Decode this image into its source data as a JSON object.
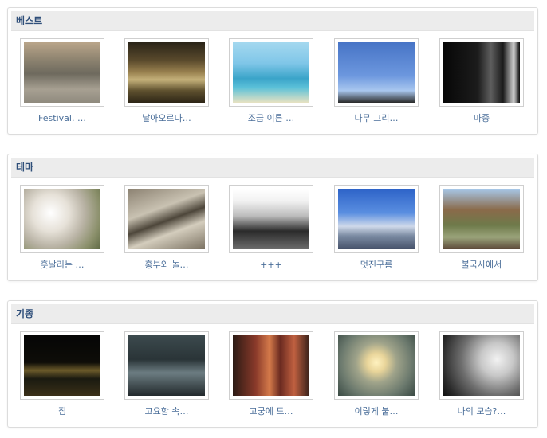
{
  "sections": [
    {
      "title": "베스트",
      "items": [
        {
          "caption": "Festival. …",
          "photo": "festival-street"
        },
        {
          "caption": "날아오르다…",
          "photo": "waves-sunset"
        },
        {
          "caption": "조금 이른 …",
          "photo": "beach-woman"
        },
        {
          "caption": "나무 그리…",
          "photo": "trees-silhouette"
        },
        {
          "caption": "마중",
          "photo": "dark-doorway"
        }
      ]
    },
    {
      "title": "테마",
      "items": [
        {
          "caption": "흣날리는 …",
          "photo": "dandelion"
        },
        {
          "caption": "홍부와 놀…",
          "photo": "salt-farm"
        },
        {
          "caption": "+++",
          "photo": "couple-silhouette"
        },
        {
          "caption": "멋진구름",
          "photo": "city-clouds"
        },
        {
          "caption": "불국사에서",
          "photo": "temple"
        }
      ]
    },
    {
      "title": "기종",
      "items": [
        {
          "caption": "집",
          "photo": "night-house"
        },
        {
          "caption": "고요함 속…",
          "photo": "lake"
        },
        {
          "caption": "고궁에 드…",
          "photo": "palace-corridor"
        },
        {
          "caption": "이렇게 불…",
          "photo": "lantern"
        },
        {
          "caption": "나의 모습?…",
          "photo": "light-bulb"
        }
      ]
    }
  ]
}
